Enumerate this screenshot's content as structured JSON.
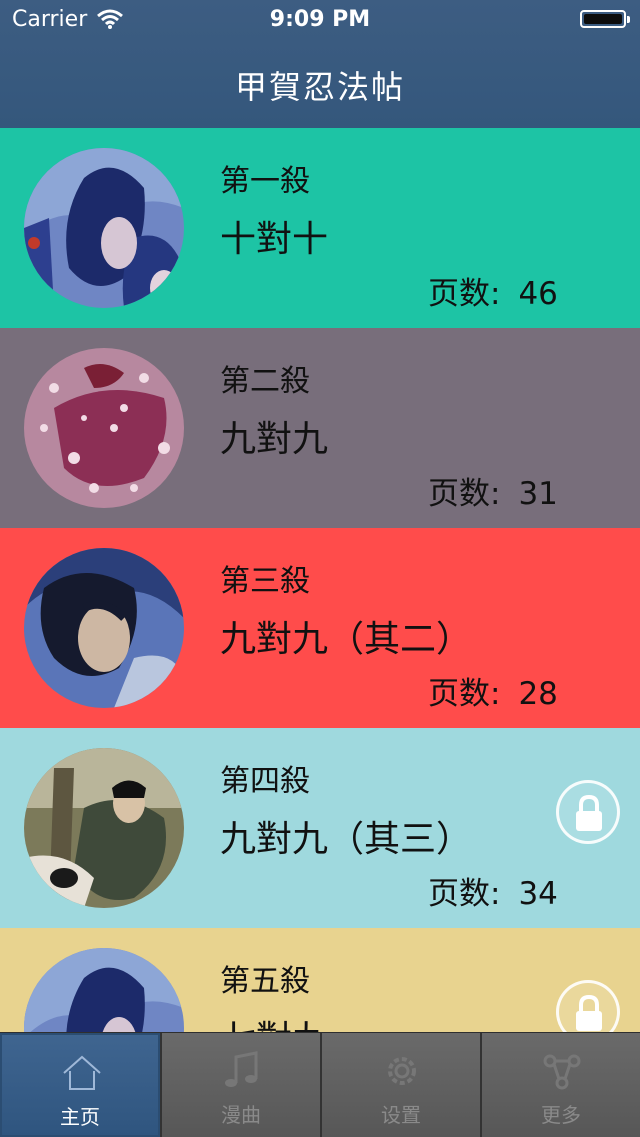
{
  "status_bar": {
    "carrier": "Carrier",
    "time": "9:09 PM"
  },
  "nav": {
    "title": "甲賀忍法帖"
  },
  "chapters": [
    {
      "chapter": "第一殺",
      "name": "十對十",
      "pages_label": "页数:",
      "pages": "46",
      "bg": "#1dc4a5",
      "locked": false
    },
    {
      "chapter": "第二殺",
      "name": "九對九",
      "pages_label": "页数:",
      "pages": "31",
      "bg": "#786e7b",
      "locked": false
    },
    {
      "chapter": "第三殺",
      "name": "九對九（其二）",
      "pages_label": "页数:",
      "pages": "28",
      "bg": "#ff4c4b",
      "locked": false
    },
    {
      "chapter": "第四殺",
      "name": "九對九（其三）",
      "pages_label": "页数:",
      "pages": "34",
      "bg": "#9fd9de",
      "locked": true
    },
    {
      "chapter": "第五殺",
      "name": "七對九",
      "pages_label": "",
      "pages": "",
      "bg": "#e8d38f",
      "locked": true
    }
  ],
  "tabs": [
    {
      "label": "主页",
      "icon": "home-icon",
      "active": true
    },
    {
      "label": "漫曲",
      "icon": "music-note-icon",
      "active": false
    },
    {
      "label": "设置",
      "icon": "gear-icon",
      "active": false
    },
    {
      "label": "更多",
      "icon": "share-icon",
      "active": false
    }
  ]
}
